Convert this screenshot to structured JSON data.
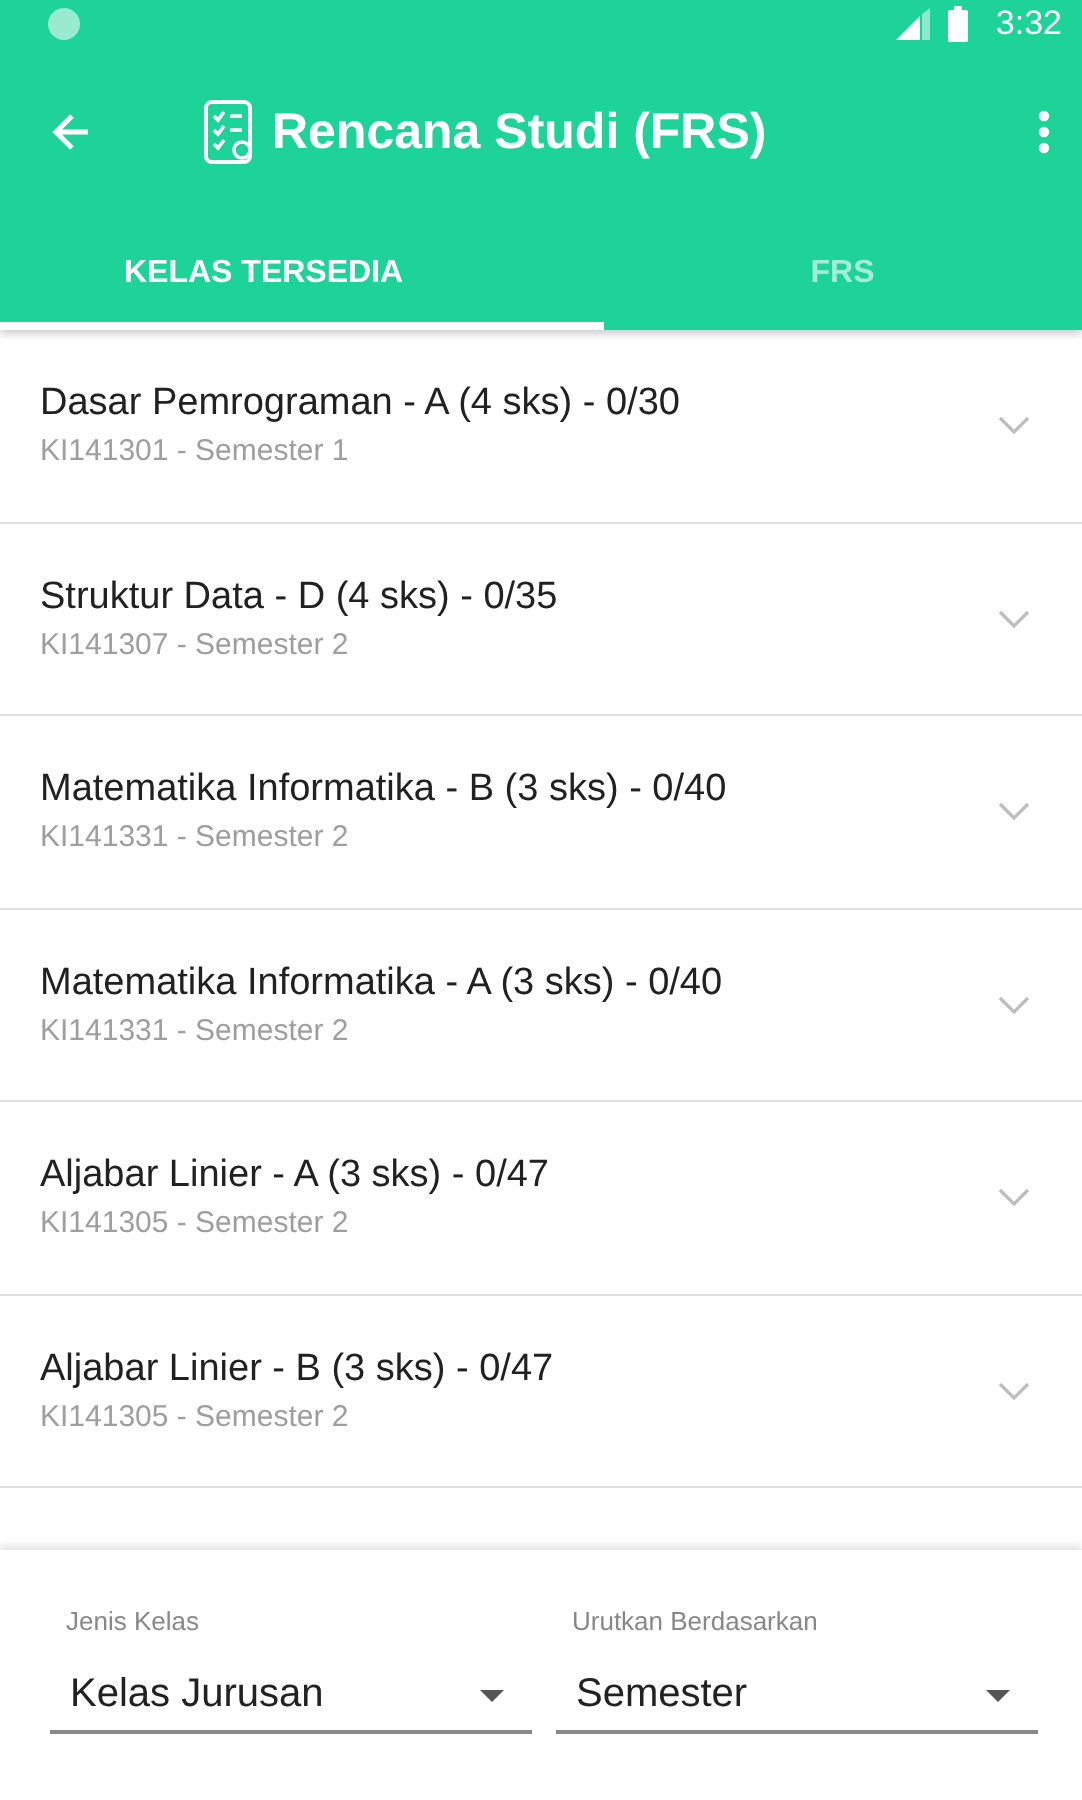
{
  "status_bar": {
    "time": "3:32"
  },
  "toolbar": {
    "title": "Rencana Studi (FRS)"
  },
  "tabs": [
    {
      "label": "KELAS TERSEDIA",
      "selected": true
    },
    {
      "label": "FRS",
      "selected": false
    }
  ],
  "courses": [
    {
      "title": "Dasar Pemrograman - A (4 sks) - 0/30",
      "subtitle": "KI141301 - Semester 1"
    },
    {
      "title": "Struktur Data - D (4 sks) - 0/35",
      "subtitle": "KI141307 - Semester 2"
    },
    {
      "title": "Matematika Informatika - B (3 sks) - 0/40",
      "subtitle": "KI141331 - Semester 2"
    },
    {
      "title": "Matematika Informatika - A (3 sks) - 0/40",
      "subtitle": "KI141331 - Semester 2"
    },
    {
      "title": "Aljabar Linier - A (3 sks) - 0/47",
      "subtitle": "KI141305 - Semester 2"
    },
    {
      "title": "Aljabar Linier - B (3 sks) - 0/47",
      "subtitle": "KI141305 - Semester 2"
    }
  ],
  "filters": [
    {
      "label": "Jenis Kelas",
      "value": "Kelas Jurusan"
    },
    {
      "label": "Urutkan Berdasarkan",
      "value": "Semester"
    }
  ]
}
